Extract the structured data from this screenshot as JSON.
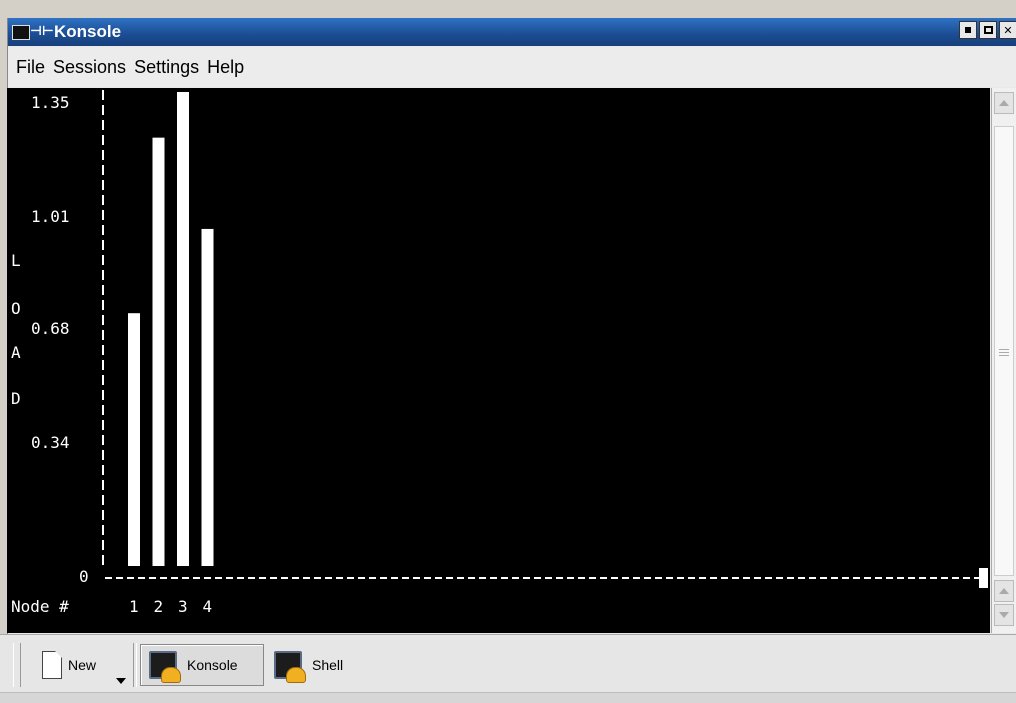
{
  "window": {
    "title": "Konsole"
  },
  "menu": {
    "items": [
      "File",
      "Sessions",
      "Settings",
      "Help"
    ]
  },
  "terminal": {
    "y_ticks": [
      "1.35",
      "1.01",
      "0.68",
      "0.34",
      "0"
    ],
    "y_axis_letters": [
      "L",
      "O",
      "A",
      "D"
    ],
    "x_label": "Node #",
    "x_categories": [
      "1",
      "2",
      "3",
      "4"
    ],
    "bar_color": "#ffffff",
    "background": "#000000"
  },
  "chart_data": {
    "type": "bar",
    "categories": [
      "1",
      "2",
      "3",
      "4"
    ],
    "values": [
      0.72,
      1.22,
      1.35,
      0.96
    ],
    "xlabel": "Node #",
    "ylabel": "LOAD",
    "ylim": [
      0,
      1.35
    ],
    "y_ticks": [
      0,
      0.34,
      0.68,
      1.01,
      1.35
    ]
  },
  "taskbar": {
    "new_label": "New",
    "tabs": [
      {
        "label": "Konsole",
        "active": true
      },
      {
        "label": "Shell",
        "active": false
      }
    ]
  }
}
